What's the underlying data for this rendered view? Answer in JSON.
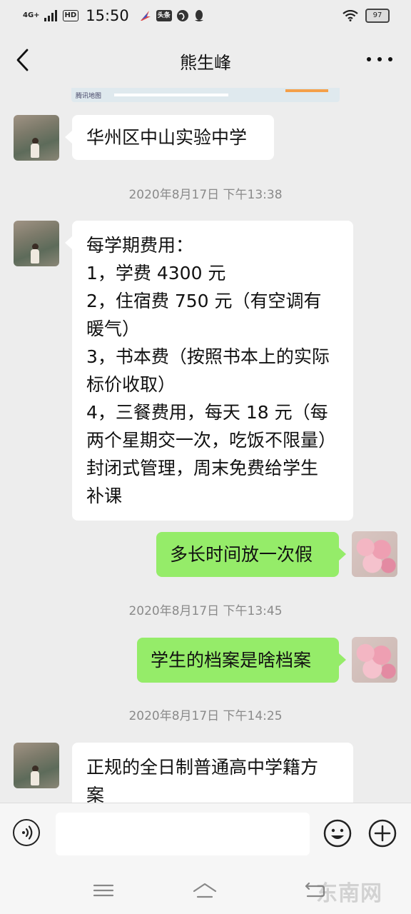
{
  "status_bar": {
    "network": "4G+",
    "hd": "HD",
    "time": "15:50",
    "toutiao_label": "头条",
    "battery": "97"
  },
  "header": {
    "title": "熊生峰"
  },
  "map_preview": {
    "label": "腾讯地图"
  },
  "messages": [
    {
      "side": "left",
      "lines": [
        "华州区中山实验中学"
      ]
    },
    {
      "timestamp": "2020年8月17日 下午13:38"
    },
    {
      "side": "left",
      "lines": [
        "每学期费用：",
        "1，学费 4300 元",
        "2，住宿费 750 元（有空调有",
        "暖气）",
        "3，书本费（按照书本上的实际",
        "标价收取）",
        "4，三餐费用，每天 18 元（每",
        "两个星期交一次，吃饭不限量）",
        "封闭式管理，周末免费给学生",
        "补课"
      ]
    },
    {
      "side": "right",
      "lines": [
        "多长时间放一次假"
      ]
    },
    {
      "timestamp": "2020年8月17日 下午13:45"
    },
    {
      "side": "right",
      "lines": [
        "学生的档案是啥档案"
      ]
    },
    {
      "timestamp": "2020年8月17日 下午14:25"
    },
    {
      "side": "left",
      "lines": [
        "正规的全日制普通高中学籍方",
        "案"
      ]
    }
  ],
  "input": {
    "value": "",
    "placeholder": ""
  },
  "watermark": "东南网"
}
